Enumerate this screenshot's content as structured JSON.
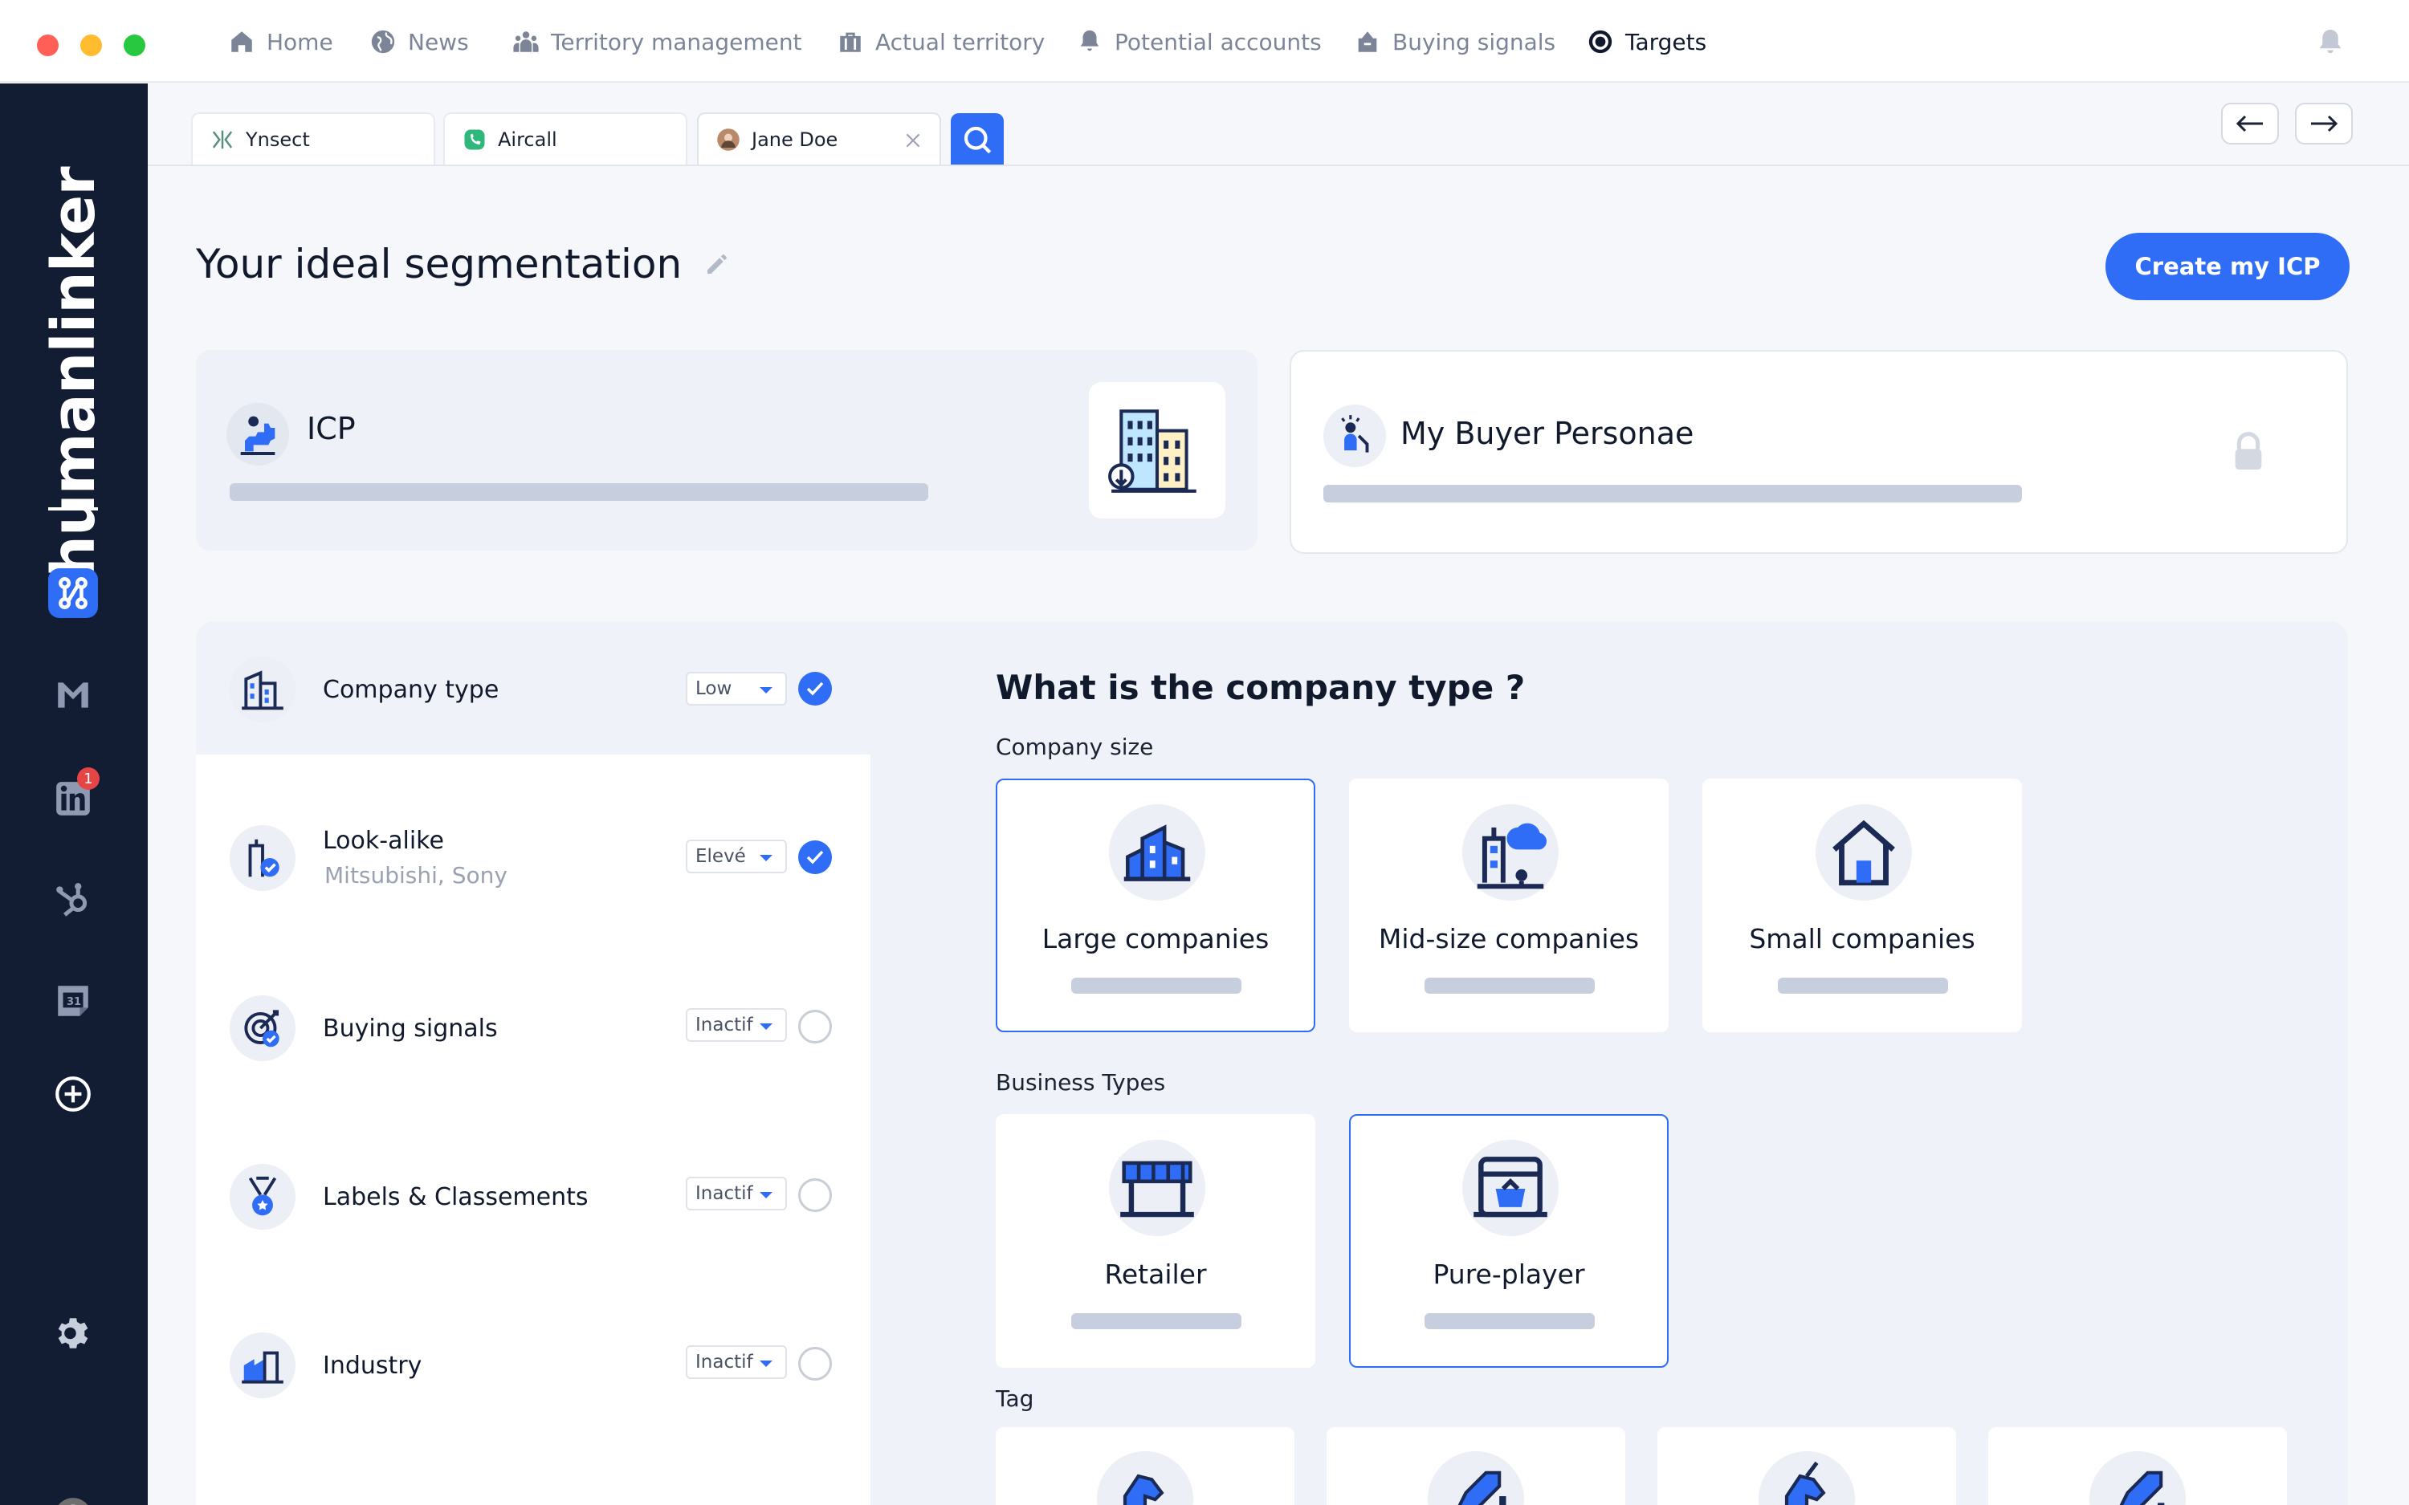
{
  "window": {
    "traffic_lights": [
      {
        "color": "#ff5f57"
      },
      {
        "color": "#febc2e"
      },
      {
        "color": "#28c840"
      }
    ]
  },
  "nav": {
    "items": [
      {
        "label": "Home",
        "icon": "home-icon"
      },
      {
        "label": "News",
        "icon": "globe-icon"
      },
      {
        "label": "Territory management",
        "icon": "team-icon"
      },
      {
        "label": "Actual territory",
        "icon": "briefcase-icon"
      },
      {
        "label": "Potential accounts",
        "icon": "bell-pin-icon"
      },
      {
        "label": "Buying signals",
        "icon": "signal-icon"
      },
      {
        "label": "Targets",
        "icon": "target-icon",
        "active": true
      }
    ],
    "notification_icon": "bell-icon"
  },
  "sidebar": {
    "brand": "humanlinker",
    "linkedin_badge": "1",
    "calendar_day": "31",
    "icons": [
      "humanlinker-app-icon",
      "gmail-icon",
      "linkedin-icon",
      "hubspot-icon",
      "calendar-icon",
      "add-icon",
      "settings-icon",
      "avatar"
    ]
  },
  "tabs": [
    {
      "label": "Ynsect",
      "icon": "ynsect-logo-icon"
    },
    {
      "label": "Aircall",
      "icon": "aircall-logo-icon"
    },
    {
      "label": "Jane Doe",
      "icon": "avatar-icon",
      "closable": true
    }
  ],
  "header": {
    "title": "Your ideal segmentation",
    "create_button": "Create my ICP"
  },
  "cards": {
    "icp": {
      "title": "ICP"
    },
    "buyer": {
      "title": "My Buyer Personae"
    }
  },
  "criteria": [
    {
      "label": "Company type",
      "sub": "",
      "level": "Low",
      "checked": true
    },
    {
      "label": "Look-alike",
      "sub": "Mitsubishi, Sony",
      "level": "Elevé",
      "checked": true
    },
    {
      "label": "Buying signals",
      "sub": "",
      "level": "Inactif",
      "checked": false
    },
    {
      "label": "Labels & Classements",
      "sub": "",
      "level": "Inactif",
      "checked": false
    },
    {
      "label": "Industry",
      "sub": "",
      "level": "Inactif",
      "checked": false
    }
  ],
  "question": {
    "title": "What is the company type ?",
    "company_size_label": "Company size",
    "company_size_options": [
      {
        "label": "Large companies",
        "selected": true
      },
      {
        "label": "Mid-size companies",
        "selected": false
      },
      {
        "label": "Small companies",
        "selected": false
      }
    ],
    "business_types_label": "Business Types",
    "business_types_options": [
      {
        "label": "Retailer",
        "selected": false
      },
      {
        "label": "Pure-player",
        "selected": true
      }
    ],
    "tag_label": "Tag"
  },
  "colors": {
    "accent": "#2f6df6",
    "sidebar": "#121c33",
    "placeholder_bar": "#c7cede"
  }
}
